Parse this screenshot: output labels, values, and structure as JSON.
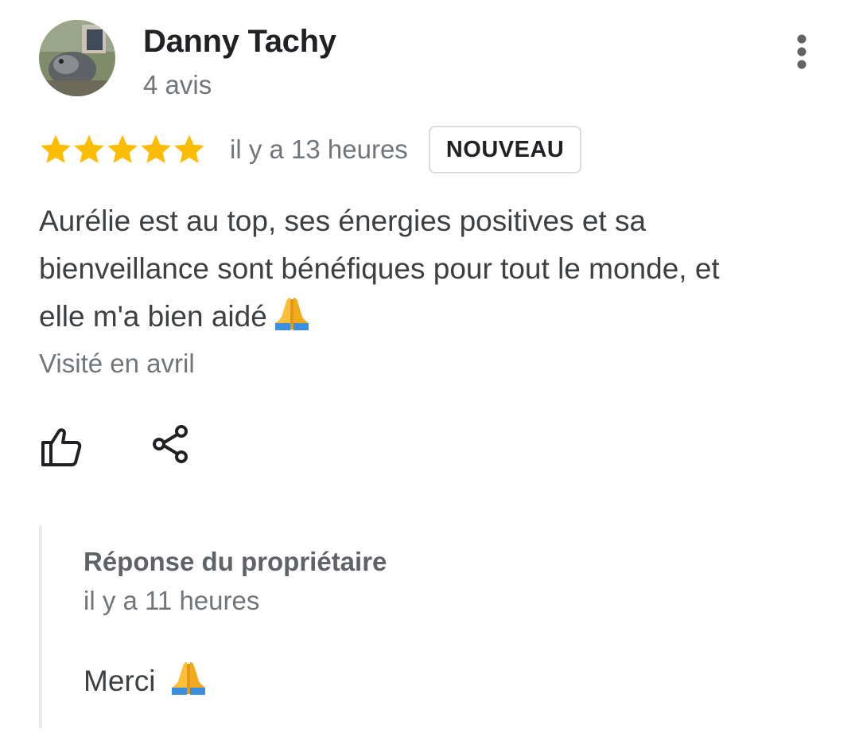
{
  "review": {
    "author": {
      "name": "Danny Tachy",
      "review_count": "4 avis"
    },
    "rating": {
      "stars": 5,
      "max_stars": 5,
      "star_color": "#fbbc04"
    },
    "timestamp": "il y a 13 heures",
    "badge": "NOUVEAU",
    "text": "Aurélie est au top, ses énergies positives et sa bienveillance sont bénéfiques pour tout le monde, et elle m'a bien aidé",
    "text_emoji": "folded-hands-emoji",
    "visit_info": "Visité en avril",
    "actions": {
      "like_icon": "thumbs-up-icon",
      "share_icon": "share-icon",
      "more_icon": "more-vertical-icon"
    }
  },
  "owner_reply": {
    "title": "Réponse du propriétaire",
    "timestamp": "il y a 11 heures",
    "text": "Merci",
    "text_emoji": "folded-hands-emoji"
  }
}
